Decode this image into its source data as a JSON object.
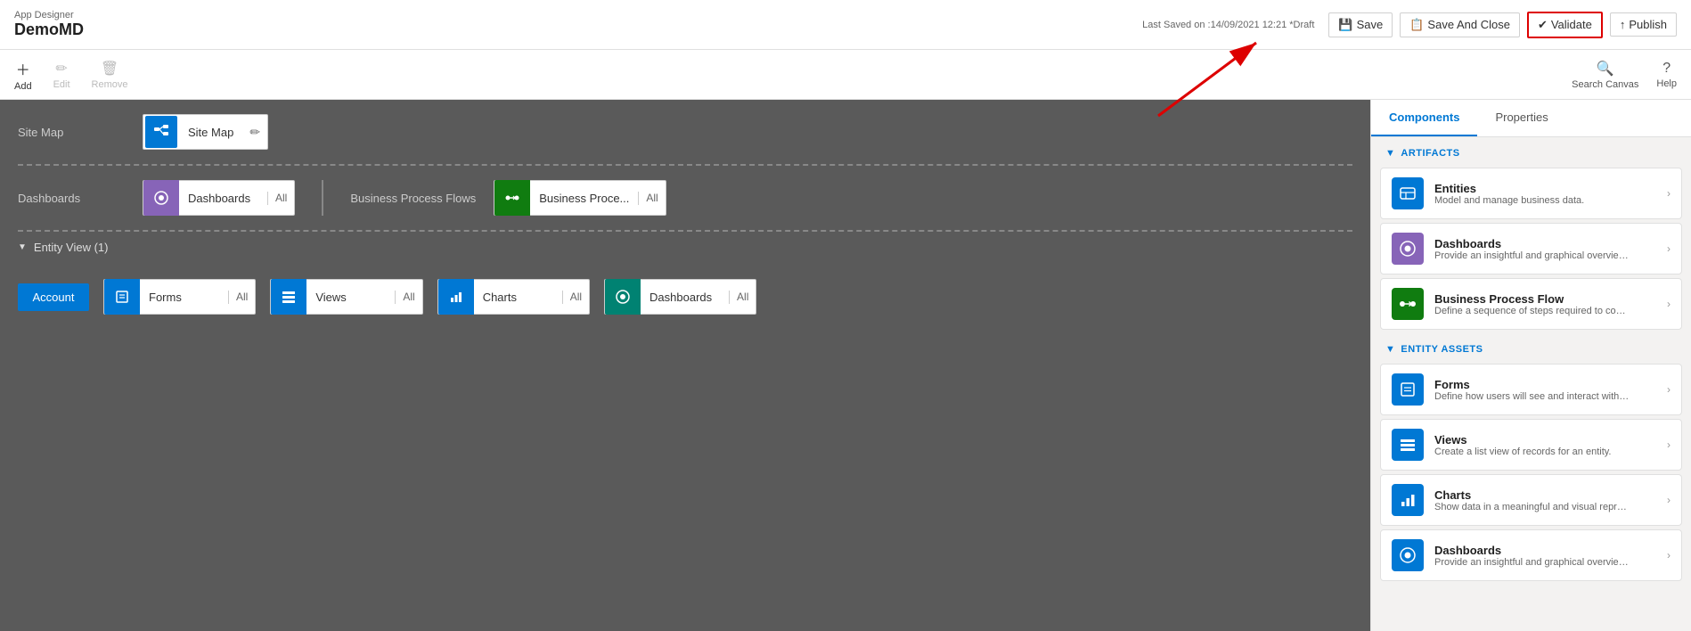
{
  "topBar": {
    "appDesignerLabel": "App Designer",
    "appName": "DemoMD",
    "saveInfo": "Last Saved on :14/09/2021 12:21 *Draft",
    "saveLabel": "Save",
    "saveAndCloseLabel": "Save And Close",
    "validateLabel": "Validate",
    "publishLabel": "Publish"
  },
  "toolbar": {
    "addLabel": "Add",
    "editLabel": "Edit",
    "removeLabel": "Remove",
    "searchCanvasLabel": "Search Canvas",
    "helpLabel": "Help"
  },
  "canvas": {
    "siteMapRow": {
      "label": "Site Map",
      "card": {
        "iconLabel": "🗺",
        "name": "Site Map"
      }
    },
    "dashboardsRow": {
      "label": "Dashboards",
      "leftCard": {
        "iconLabel": "⊙",
        "name": "Dashboards",
        "allLabel": "All"
      },
      "bpfLabel": "Business Process Flows",
      "rightCard": {
        "iconLabel": "🔗",
        "name": "Business Proce...",
        "allLabel": "All"
      }
    },
    "entitySection": {
      "headerLabel": "Entity View (1)",
      "accountLabel": "Account",
      "formsCard": {
        "iconLabel": "≡",
        "name": "Forms",
        "allLabel": "All"
      },
      "viewsCard": {
        "iconLabel": "⊞",
        "name": "Views",
        "allLabel": "All"
      },
      "chartsCard": {
        "iconLabel": "📊",
        "name": "Charts",
        "allLabel": "All"
      },
      "dashboardsCard": {
        "iconLabel": "⊙",
        "name": "Dashboards",
        "allLabel": "All"
      }
    }
  },
  "rightPanel": {
    "tabs": [
      {
        "id": "components",
        "label": "Components",
        "active": true
      },
      {
        "id": "properties",
        "label": "Properties",
        "active": false
      }
    ],
    "artifacts": {
      "sectionLabel": "ARTIFACTS",
      "items": [
        {
          "id": "entities",
          "iconColor": "#0078d4",
          "iconSymbol": "▦",
          "title": "Entities",
          "desc": "Model and manage business data."
        },
        {
          "id": "dashboards",
          "iconColor": "#8764b8",
          "iconSymbol": "⊙",
          "title": "Dashboards",
          "desc": "Provide an insightful and graphical overview of bu..."
        },
        {
          "id": "bpf",
          "iconColor": "#107c10",
          "iconSymbol": "⟳",
          "title": "Business Process Flow",
          "desc": "Define a sequence of steps required to complete ..."
        }
      ]
    },
    "entityAssets": {
      "sectionLabel": "ENTITY ASSETS",
      "items": [
        {
          "id": "forms",
          "iconColor": "#0078d4",
          "iconSymbol": "≡",
          "title": "Forms",
          "desc": "Define how users will see and interact with busine..."
        },
        {
          "id": "views",
          "iconColor": "#0078d4",
          "iconSymbol": "⊞",
          "title": "Views",
          "desc": "Create a list view of records for an entity."
        },
        {
          "id": "charts",
          "iconColor": "#0078d4",
          "iconSymbol": "📊",
          "title": "Charts",
          "desc": "Show data in a meaningful and visual representati..."
        },
        {
          "id": "dashboards2",
          "iconColor": "#0078d4",
          "iconSymbol": "⊙",
          "title": "Dashboards",
          "desc": "Provide an insightful and graphical overview of bu..."
        }
      ]
    }
  }
}
